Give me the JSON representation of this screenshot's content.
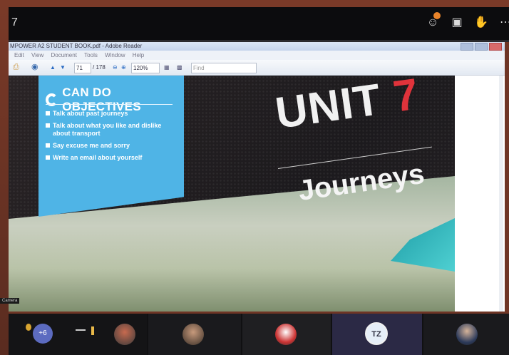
{
  "meeting": {
    "title_fragment": "7"
  },
  "reader": {
    "window_title": "MPOWER A2 STUDENT BOOK.pdf - Adobe Reader",
    "menu": [
      "Edit",
      "View",
      "Document",
      "Tools",
      "Window",
      "Help"
    ],
    "page_current": "71",
    "page_total": "/ 178",
    "zoom": "120%",
    "find_placeholder": "Find"
  },
  "slide": {
    "objectives_title": "CAN DO OBJECTIVES",
    "objectives": [
      "Talk about past journeys",
      "Talk about what you like and dislike about transport",
      "Say excuse me and sorry",
      "Write an email about yourself"
    ],
    "unit_word": "UNIT",
    "unit_number": "7",
    "unit_subtitle": "Journeys"
  },
  "caption": "Camera",
  "participants": {
    "overflow_count": "+6",
    "initials_tile": "TZ"
  }
}
